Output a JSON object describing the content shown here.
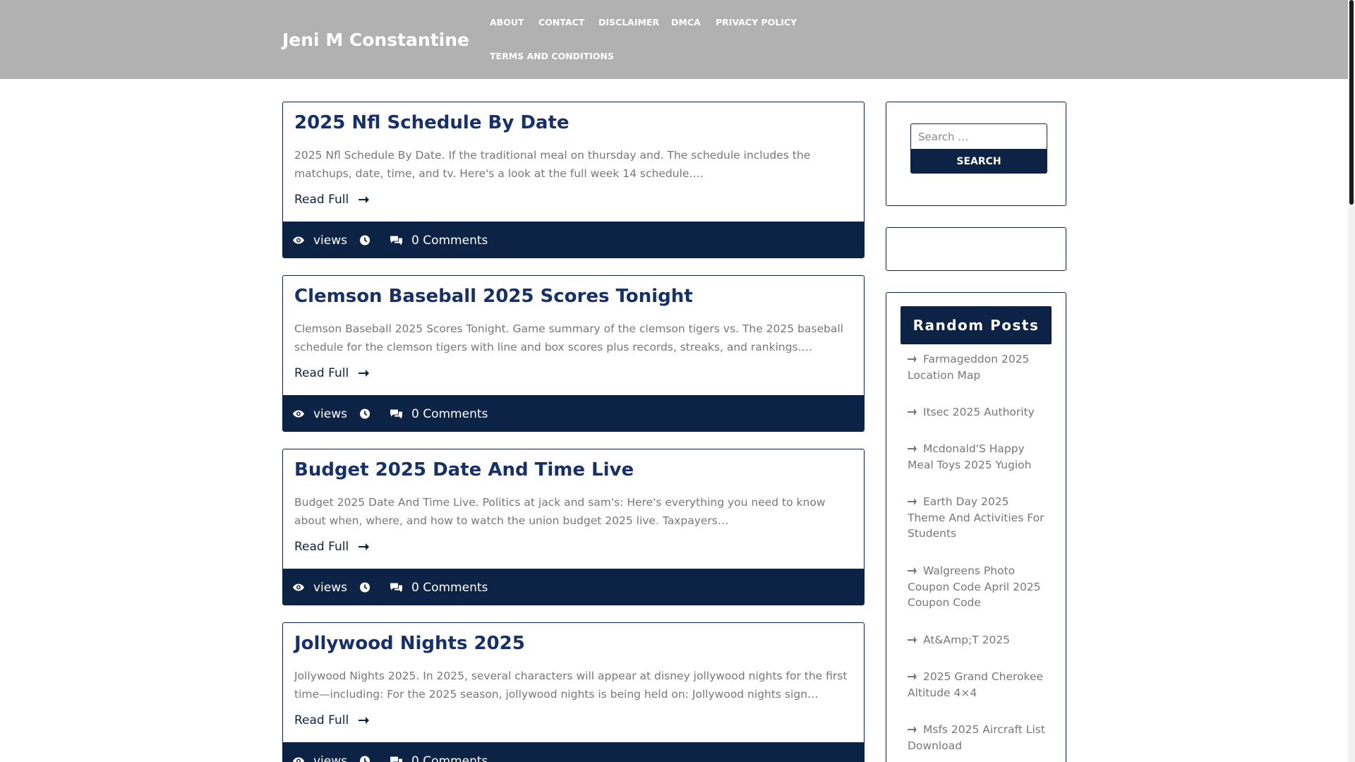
{
  "site": {
    "title": "Jeni M Constantine"
  },
  "nav": [
    {
      "label": "About"
    },
    {
      "label": "Contact"
    },
    {
      "label": "Disclaimer"
    },
    {
      "label": "DMCA"
    },
    {
      "label": "Privacy Policy"
    },
    {
      "label": "Terms and Conditions"
    }
  ],
  "posts": [
    {
      "title": "2025 Nfl Schedule By Date",
      "excerpt": "2025 Nfl Schedule By Date. If the traditional meal on thursday and. The schedule includes the matchups, date, time, and tv. Here's a look at the full week 14 schedule.…",
      "read_more": "Read Full",
      "views": "views",
      "comments": "0 Comments"
    },
    {
      "title": "Clemson Baseball 2025 Scores Tonight",
      "excerpt": "Clemson Baseball 2025 Scores Tonight. Game summary of the clemson tigers vs. The 2025 baseball schedule for the clemson tigers with line and box scores plus records, streaks, and rankings.…",
      "read_more": "Read Full",
      "views": "views",
      "comments": "0 Comments"
    },
    {
      "title": "Budget 2025 Date And Time Live",
      "excerpt": "Budget 2025 Date And Time Live. Politics at jack and sam's: Here's everything you need to know about when, where, and how to watch the union budget 2025 live. Taxpayers…",
      "read_more": "Read Full",
      "views": "views",
      "comments": "0 Comments"
    },
    {
      "title": "Jollywood Nights 2025",
      "excerpt": "Jollywood Nights 2025. In 2025, several characters will appear at disney jollywood nights for the first time—including: For the 2025 season, jollywood nights is being held on: Jollywood nights sign…",
      "read_more": "Read Full",
      "views": "views",
      "comments": "0 Comments"
    }
  ],
  "search": {
    "placeholder": "Search …",
    "button_label": "Search"
  },
  "random_posts": {
    "heading": "Random Posts",
    "items": [
      "Farmageddon 2025 Location Map",
      "Itsec 2025 Authority",
      "Mcdonald'S Happy Meal Toys 2025 Yugioh",
      "Earth Day 2025 Theme And Activities For Students",
      "Walgreens Photo Coupon Code April 2025 Coupon Code",
      "At&Amp;T 2025",
      "2025 Grand Cherokee Altitude 4×4",
      "Msfs 2025 Aircraft List Download"
    ]
  },
  "colors": {
    "header_bg": "#b1b1b1",
    "primary": "#0d2345",
    "title": "#16306b"
  }
}
